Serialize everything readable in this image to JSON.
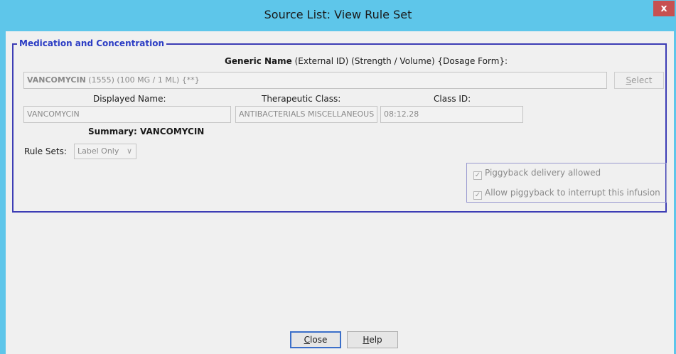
{
  "window": {
    "title": "Source List:  View Rule Set",
    "close_glyph": "x"
  },
  "group": {
    "title": "Medication and Concentration"
  },
  "generic": {
    "header_bold": "Generic Name",
    "header_rest": " (External ID)  (Strength / Volume)  {Dosage Form}:",
    "value_bold": "VANCOMYCIN",
    "value_rest": " (1555) (100 MG / 1 ML) {**}",
    "select_first": "S",
    "select_rest": "elect"
  },
  "details": {
    "displayed_name_label": "Displayed Name:",
    "therapeutic_class_label": "Therapeutic Class:",
    "class_id_label": "Class ID:",
    "displayed_name_value": "VANCOMYCIN",
    "therapeutic_class_value": "ANTIBACTERIALS MISCELLANEOUS",
    "class_id_value": "08:12.28"
  },
  "summary": {
    "text": "Summary: VANCOMYCIN"
  },
  "rule_sets": {
    "label": "Rule Sets:",
    "selected": "Label Only",
    "chevron": "∨"
  },
  "options": {
    "piggyback_allowed": "Piggyback delivery allowed",
    "piggyback_interrupt": "Allow piggyback to interrupt this infusion",
    "piggyback_allowed_checked": true,
    "piggyback_interrupt_checked": true,
    "check_glyph": "✓"
  },
  "footer": {
    "close_first": "C",
    "close_rest": "lose",
    "help_first": "H",
    "help_rest": "elp"
  }
}
